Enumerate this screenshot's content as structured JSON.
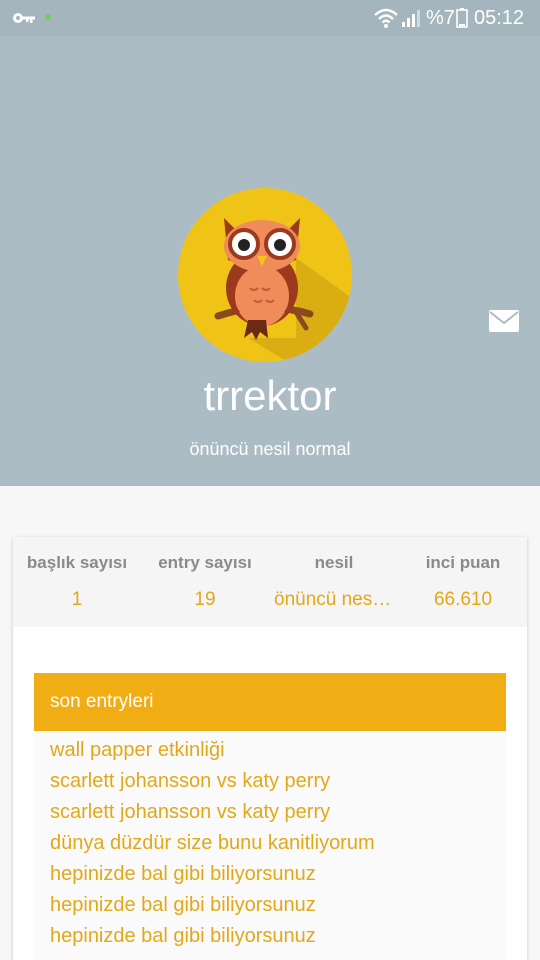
{
  "status_bar": {
    "battery": "%7",
    "time": "05:12",
    "icons": [
      "key-icon",
      "wifi-icon",
      "signal-icon",
      "battery-icon"
    ]
  },
  "profile": {
    "username": "trrektor",
    "generation": "önüncü nesil normal",
    "avatar": "owl-avatar",
    "mail_icon": "mail-icon"
  },
  "stats": [
    {
      "label": "başlık sayısı",
      "value": "1"
    },
    {
      "label": "entry sayısı",
      "value": "19"
    },
    {
      "label": "nesil",
      "value": "önüncü nesil normal"
    },
    {
      "label": "inci puan",
      "value": "66.610"
    }
  ],
  "entries": {
    "title": "son entryleri",
    "items": [
      "wall papper etkinliği",
      "scarlett johansson vs katy perry",
      "scarlett johansson vs katy perry",
      "dünya düzdür size bunu kanitliyorum",
      "hepinizde bal gibi biliyorsunuz",
      "hepinizde bal gibi biliyorsunuz",
      "hepinizde bal gibi biliyorsunuz"
    ]
  },
  "colors": {
    "header_bg": "#acbcc4",
    "accent": "#f1ad14",
    "link": "#e3a818",
    "avatar_bg": "#f0c417"
  }
}
